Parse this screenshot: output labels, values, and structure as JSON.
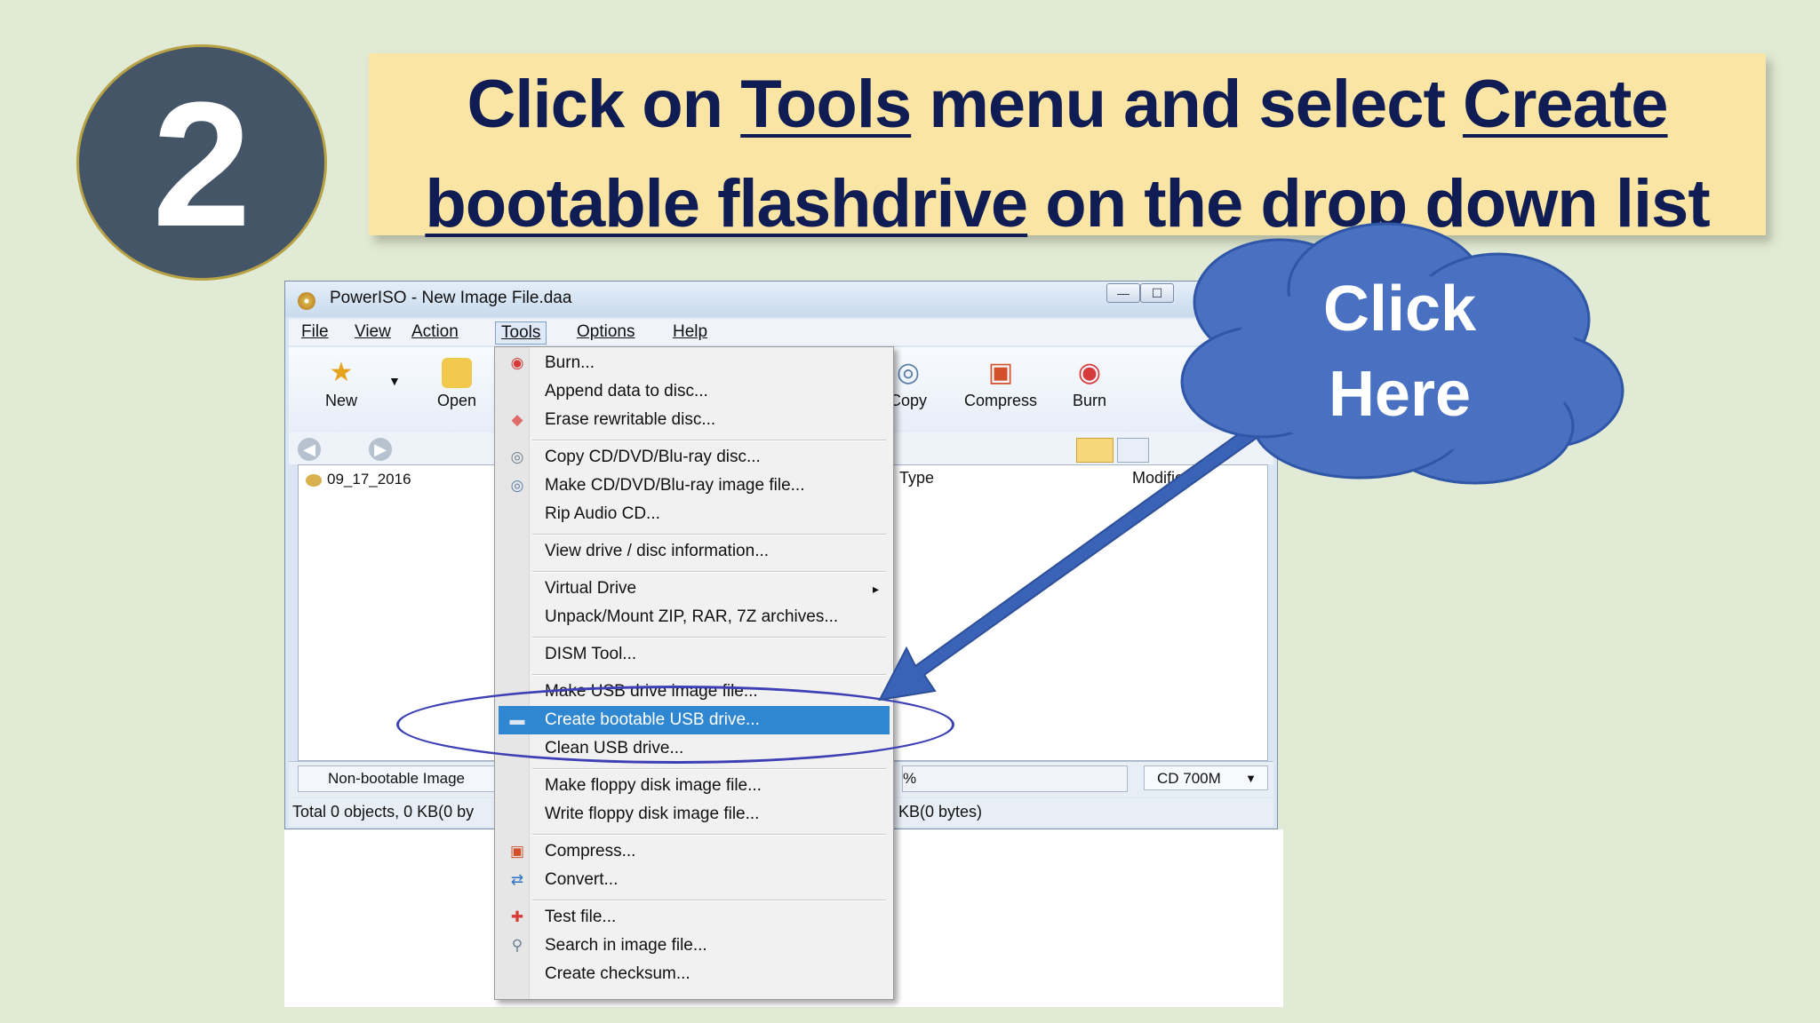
{
  "step": {
    "number": "2"
  },
  "banner": {
    "line1": {
      "part1": "Click on ",
      "tools": "Tools",
      "part2": " menu and select ",
      "create": "Create"
    },
    "line2": {
      "bootable": "bootable flashdrive",
      "part3": " on the drop down list"
    }
  },
  "window": {
    "title": "PowerISO - New Image File.daa",
    "controls": {
      "minimize": "—",
      "maximize": "☐"
    },
    "menubar": [
      "File",
      "View",
      "Action",
      "Tools",
      "Options",
      "Help"
    ],
    "toolbar": [
      {
        "label": "New",
        "icon": "star-icon"
      },
      {
        "label": "Open",
        "icon": "folder-icon"
      },
      {
        "label": "Copy",
        "icon": "disc-copy-icon"
      },
      {
        "label": "Compress",
        "icon": "compress-icon"
      },
      {
        "label": "Burn",
        "icon": "burn-icon"
      }
    ],
    "tree": {
      "item": "09_17_2016"
    },
    "columns": {
      "type": "Type",
      "modified": "Modified"
    },
    "status": {
      "left": "Non-bootable Image",
      "progress": "%",
      "media": "CD 700M"
    },
    "totals": {
      "left": "Total 0 objects, 0 KB(0 by",
      "right": "KB(0 bytes)"
    }
  },
  "tools_menu": {
    "items": [
      {
        "label": "Burn...",
        "icon": "burn-icon"
      },
      {
        "label": "Append data to disc...",
        "icon": ""
      },
      {
        "label": "Erase rewritable disc...",
        "icon": "eraser-icon"
      },
      {
        "label": "Copy CD/DVD/Blu-ray disc...",
        "icon": "disc-copy-icon"
      },
      {
        "label": "Make CD/DVD/Blu-ray image file...",
        "icon": "disc-image-icon"
      },
      {
        "label": "Rip Audio CD...",
        "icon": ""
      },
      {
        "label": "View drive / disc information...",
        "icon": ""
      },
      {
        "label": "Virtual Drive",
        "icon": ""
      },
      {
        "label": "Unpack/Mount ZIP, RAR, 7Z archives...",
        "icon": ""
      },
      {
        "label": "DISM Tool...",
        "icon": ""
      },
      {
        "label": "Make USB drive image file...",
        "icon": ""
      },
      {
        "label": "Create bootable USB drive...",
        "icon": "usb-icon"
      },
      {
        "label": "Clean USB drive...",
        "icon": ""
      },
      {
        "label": "Make floppy disk image file...",
        "icon": ""
      },
      {
        "label": "Write floppy disk image file...",
        "icon": ""
      },
      {
        "label": "Compress...",
        "icon": "compress-icon"
      },
      {
        "label": "Convert...",
        "icon": "convert-icon"
      },
      {
        "label": "Test file...",
        "icon": "test-icon"
      },
      {
        "label": "Search in image file...",
        "icon": "search-icon"
      },
      {
        "label": "Create checksum...",
        "icon": ""
      }
    ],
    "selected_index": 11,
    "submenu_arrow": "▸"
  },
  "callout": {
    "line1": "Click",
    "line2": "Here"
  },
  "colors": {
    "background": "#e1ead4",
    "banner": "#fbe5a5",
    "banner_text": "#0f1d54",
    "badge": "#445567",
    "callout": "#4a70c2",
    "selection": "#2f86d1",
    "ellipse": "#3d3fb5",
    "arrow": "#3a63b8"
  }
}
